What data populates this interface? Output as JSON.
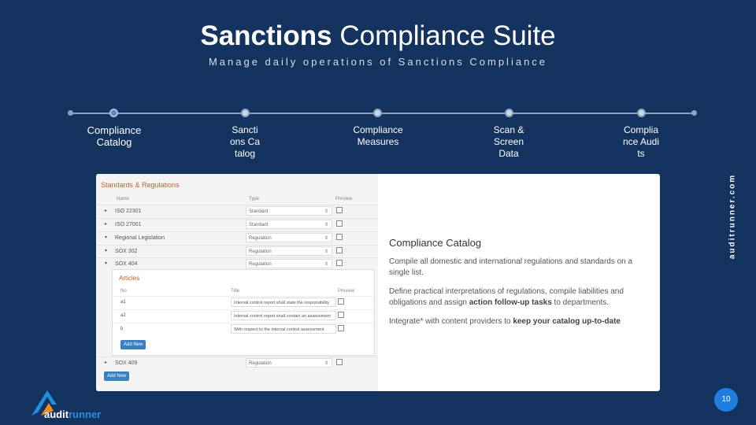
{
  "header": {
    "title_bold": "Sanctions",
    "title_rest": " Compliance Suite",
    "subtitle": "Manage daily operations of Sanctions Compliance"
  },
  "timeline": {
    "steps": [
      {
        "label": "Compliance Catalog"
      },
      {
        "label": "Sanctions Catalog"
      },
      {
        "label": "Compliance Measures"
      },
      {
        "label": "Scan & Screen Data"
      },
      {
        "label": "Compliance Audits"
      }
    ]
  },
  "side_label": "auditrunner.com",
  "screenshot": {
    "header": "Standards & Regulations",
    "col_name": "Name",
    "col_type": "Type",
    "col_preview": "Preview",
    "rows": [
      {
        "name": "ISO 22301",
        "type": "Standard"
      },
      {
        "name": "ISO 27001",
        "type": "Standard"
      },
      {
        "name": "Regional Legislation",
        "type": "Regulation"
      },
      {
        "name": "SOX 302",
        "type": "Regulation"
      },
      {
        "name": "SOX 404",
        "type": "Regulation"
      }
    ],
    "articles": {
      "header": "Articles",
      "col_no": "No",
      "col_title": "Title",
      "col_preview": "Preview",
      "rows": [
        {
          "no": "a1",
          "title": "Internal control report shall state the responsibility"
        },
        {
          "no": "a2",
          "title": "Internal control report shall contain an assessment"
        },
        {
          "no": "b",
          "title": "With respect to the internal control assessment"
        }
      ],
      "add_label": "Add New"
    },
    "last_row": {
      "name": "SOX 409",
      "type": "Regulation"
    },
    "add_label": "Add New"
  },
  "info": {
    "heading": "Compliance Catalog",
    "p1": "Compile all domestic and international regulations and standards on a single list.",
    "p2_pre": "Define practical interpretations of regulations, compile liabilities and obligations and assign ",
    "p2_bold": "action follow-up tasks",
    "p2_post": " to departments.",
    "p3_pre": "Integrate* with content providers to ",
    "p3_bold": "keep your catalog up-to-date"
  },
  "logo": {
    "part1": "audit",
    "part2": "runner"
  },
  "page_number": "10"
}
